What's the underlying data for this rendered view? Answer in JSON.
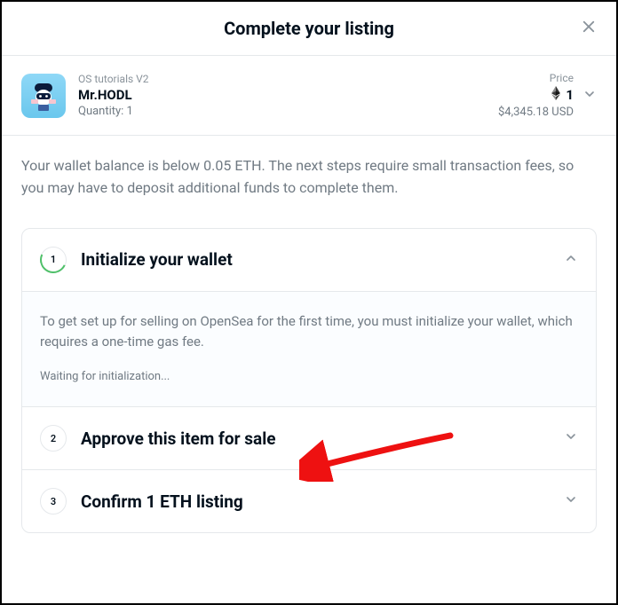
{
  "header": {
    "title": "Complete your listing"
  },
  "item": {
    "collection": "OS tutorials V2",
    "name": "Mr.HODL",
    "quantity": "Quantity: 1",
    "price_label": "Price",
    "price_value": "1",
    "price_usd": "$4,345.18 USD"
  },
  "warning": "Your wallet balance is below 0.05 ETH. The next steps require small transaction fees, so you may have to deposit additional funds to complete them.",
  "steps": [
    {
      "num": "1",
      "title": "Initialize your wallet",
      "desc": "To get set up for selling on OpenSea for the first time, you must initialize your wallet, which requires a one-time gas fee.",
      "waiting": "Waiting for initialization..."
    },
    {
      "num": "2",
      "title": "Approve this item for sale"
    },
    {
      "num": "3",
      "title": "Confirm 1 ETH listing"
    }
  ]
}
